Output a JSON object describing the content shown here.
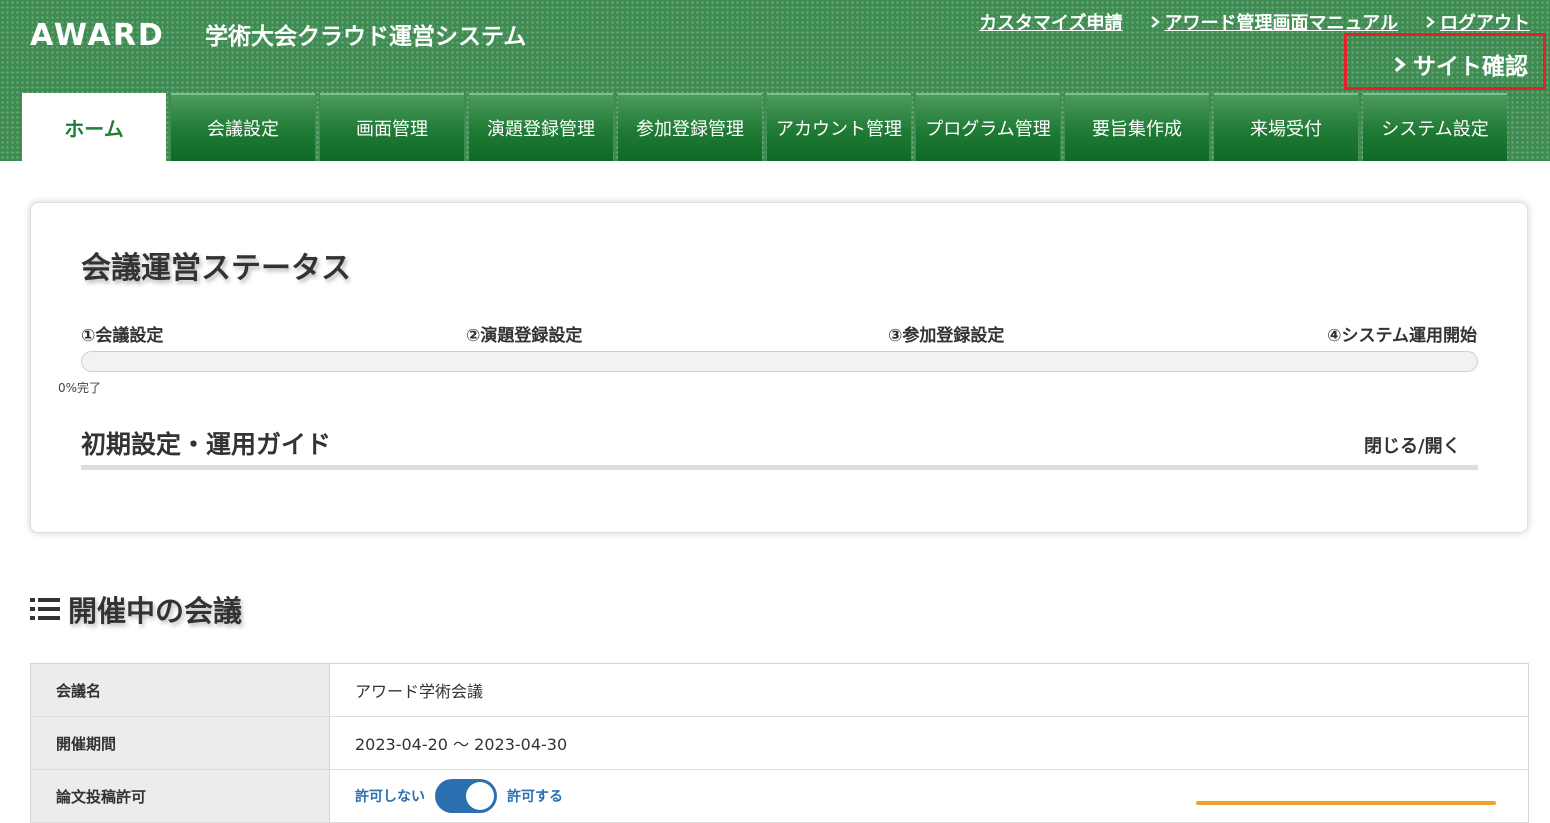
{
  "header": {
    "logo": "AWARD",
    "app_title": "学術大会クラウド運営システム",
    "links": [
      {
        "label": "カスタマイズ申請",
        "chevron": false
      },
      {
        "label": "アワード管理画面マニュアル",
        "chevron": true
      },
      {
        "label": "ログアウト",
        "chevron": true
      }
    ],
    "site_check": "サイト確認",
    "highlight_color": "#e4202b"
  },
  "nav": {
    "tabs": [
      {
        "label": "ホーム",
        "active": true
      },
      {
        "label": "会議設定",
        "active": false
      },
      {
        "label": "画面管理",
        "active": false
      },
      {
        "label": "演題登録管理",
        "active": false
      },
      {
        "label": "参加登録管理",
        "active": false
      },
      {
        "label": "アカウント管理",
        "active": false
      },
      {
        "label": "プログラム管理",
        "active": false
      },
      {
        "label": "要旨集作成",
        "active": false
      },
      {
        "label": "来場受付",
        "active": false
      },
      {
        "label": "システム設定",
        "active": false
      }
    ]
  },
  "status": {
    "title": "会議運営ステータス",
    "steps": [
      "①会議設定",
      "②演題登録設定",
      "③参加登録設定",
      "④システム運用開始"
    ],
    "progress_percent": 0,
    "progress_label": "0%完了",
    "guide_title": "初期設定・運用ガイド",
    "guide_toggle": "閉じる/開く"
  },
  "section": {
    "title": "開催中の会議"
  },
  "conference_table": {
    "rows": [
      {
        "label": "会議名",
        "value": "アワード学術会議"
      },
      {
        "label": "開催期間",
        "value": "2023-04-20 ～ 2023-04-30"
      },
      {
        "label": "論文投稿許可",
        "off_label": "許可しない",
        "on_label": "許可する",
        "enabled": true
      }
    ]
  },
  "colors": {
    "header_green": "#3f8c52",
    "tab_green": "#1f7a35",
    "active_tab_text": "#1e7f37",
    "toggle_blue": "#2a6fb0"
  }
}
